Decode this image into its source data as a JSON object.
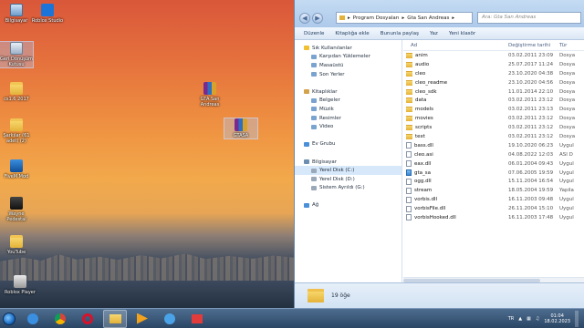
{
  "desktop": {
    "icons": [
      {
        "label": "Bilgisayar",
        "kind": "computer"
      },
      {
        "label": "Roblox Studio",
        "kind": "app"
      },
      {
        "label": "Geri Dönüşüm Kutusu",
        "kind": "recycle"
      },
      {
        "label": "cs1.6 2017",
        "kind": "folder"
      },
      {
        "label": "GTA San Andreas",
        "kind": "archive"
      },
      {
        "label": "Şarkılar (61 adet) (2)",
        "kind": "folder"
      },
      {
        "label": "GTASA",
        "kind": "archive"
      },
      {
        "label": "FiveM Mod",
        "kind": "app"
      },
      {
        "label": "Wayne Pedestal",
        "kind": "app"
      },
      {
        "label": "YouTube",
        "kind": "folder"
      },
      {
        "label": "Roblox Player",
        "kind": "app"
      }
    ]
  },
  "explorer": {
    "breadcrumb": [
      "Program Dosyaları",
      "Gta San Andreas"
    ],
    "search_placeholder": "Ara: Gta San Andreas",
    "toolbar": [
      "Düzenle",
      "Kitaplığa ekle",
      "Bununla paylaş",
      "Yaz",
      "Yeni klasör"
    ],
    "nav": [
      {
        "label": "Sık Kullanılanlar",
        "level": 0,
        "icon": "star-icon"
      },
      {
        "label": "Karşıdan Yüklemeler",
        "level": 1,
        "icon": "downloads-icon"
      },
      {
        "label": "Masaüstü",
        "level": 1,
        "icon": "desktop-icon"
      },
      {
        "label": "Son Yerler",
        "level": 1,
        "icon": "recent-places-icon"
      },
      {
        "label": "",
        "level": -1,
        "icon": ""
      },
      {
        "label": "Kitaplıklar",
        "level": 0,
        "icon": "libraries-icon"
      },
      {
        "label": "Belgeler",
        "level": 1,
        "icon": "documents-icon"
      },
      {
        "label": "Müzik",
        "level": 1,
        "icon": "music-icon"
      },
      {
        "label": "Resimler",
        "level": 1,
        "icon": "pictures-icon"
      },
      {
        "label": "Video",
        "level": 1,
        "icon": "video-icon"
      },
      {
        "label": "",
        "level": -1,
        "icon": ""
      },
      {
        "label": "Ev Grubu",
        "level": 0,
        "icon": "homegroup-icon"
      },
      {
        "label": "",
        "level": -1,
        "icon": ""
      },
      {
        "label": "Bilgisayar",
        "level": 0,
        "icon": "computer-icon"
      },
      {
        "label": "Yerel Disk (C:)",
        "level": 1,
        "icon": "drive-icon",
        "active": true
      },
      {
        "label": "Yerel Disk (D:)",
        "level": 1,
        "icon": "drive-icon"
      },
      {
        "label": "Sistem Ayrıldı (G:)",
        "level": 1,
        "icon": "drive-icon"
      },
      {
        "label": "",
        "level": -1,
        "icon": ""
      },
      {
        "label": "Ağ",
        "level": 0,
        "icon": "network-icon"
      }
    ],
    "columns": {
      "name": "Ad",
      "date": "Değiştirme tarihi",
      "type": "Tür"
    },
    "files": [
      {
        "name": "anim",
        "date": "03.02.2011 23:09",
        "type": "Dosya",
        "kind": "folder"
      },
      {
        "name": "audio",
        "date": "25.07.2017 11:24",
        "type": "Dosya",
        "kind": "folder"
      },
      {
        "name": "cleo",
        "date": "23.10.2020 04:38",
        "type": "Dosya",
        "kind": "folder"
      },
      {
        "name": "cleo_readme",
        "date": "23.10.2020 04:56",
        "type": "Dosya",
        "kind": "folder"
      },
      {
        "name": "cleo_sdk",
        "date": "11.01.2014 22:10",
        "type": "Dosya",
        "kind": "folder"
      },
      {
        "name": "data",
        "date": "03.02.2011 23:12",
        "type": "Dosya",
        "kind": "folder"
      },
      {
        "name": "models",
        "date": "03.02.2011 23:13",
        "type": "Dosya",
        "kind": "folder"
      },
      {
        "name": "movies",
        "date": "03.02.2011 23:12",
        "type": "Dosya",
        "kind": "folder"
      },
      {
        "name": "scripts",
        "date": "03.02.2011 23:12",
        "type": "Dosya",
        "kind": "folder"
      },
      {
        "name": "text",
        "date": "03.02.2011 23:12",
        "type": "Dosya",
        "kind": "folder"
      },
      {
        "name": "bass.dll",
        "date": "19.10.2020 06:23",
        "type": "Uygul",
        "kind": "file"
      },
      {
        "name": "cleo.asi",
        "date": "04.08.2022 12:03",
        "type": "ASI D",
        "kind": "file"
      },
      {
        "name": "eax.dll",
        "date": "06.01.2004 09:43",
        "type": "Uygul",
        "kind": "file"
      },
      {
        "name": "gta_sa",
        "date": "07.06.2005 19:59",
        "type": "Uygul",
        "kind": "exe"
      },
      {
        "name": "ogg.dll",
        "date": "15.11.2004 16:54",
        "type": "Uygul",
        "kind": "file"
      },
      {
        "name": "stream",
        "date": "18.05.2004 19:59",
        "type": "Yapila",
        "kind": "file"
      },
      {
        "name": "vorbis.dll",
        "date": "16.11.2003 09:48",
        "type": "Uygul",
        "kind": "file"
      },
      {
        "name": "vorbisFile.dll",
        "date": "26.11.2004 15:10",
        "type": "Uygul",
        "kind": "file"
      },
      {
        "name": "vorbisHooked.dll",
        "date": "16.11.2003 17:48",
        "type": "Uygul",
        "kind": "file"
      }
    ],
    "item_count": "19 öğe"
  },
  "taskbar": {
    "apps": [
      "internet-explorer-icon",
      "chrome-icon",
      "opera-icon",
      "explorer-icon",
      "media-player-icon",
      "browser-icon",
      "app-icon"
    ],
    "language": "TR",
    "time": "01:04",
    "date": "18.02.2023"
  }
}
